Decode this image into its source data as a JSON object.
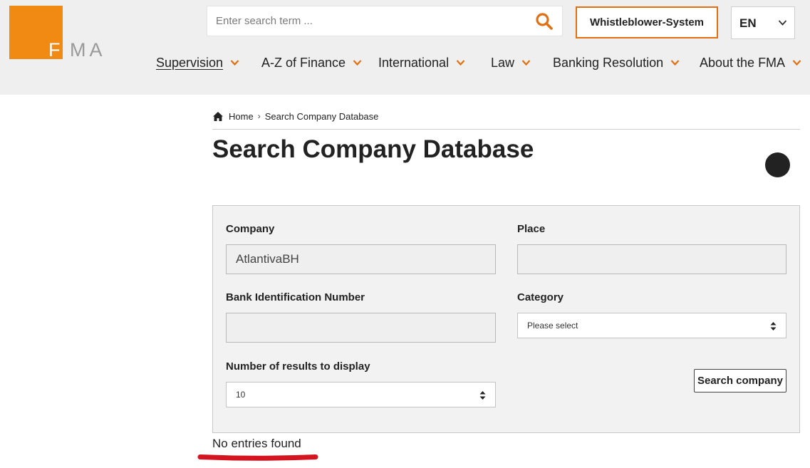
{
  "header": {
    "logo": {
      "letter_f": "F",
      "letters_ma": "MA",
      "brand_color": "#f08a12"
    },
    "search": {
      "placeholder": "Enter search term ...",
      "icon": "search-icon"
    },
    "whistleblower_label": "Whistleblower-System",
    "language": {
      "selected": "EN",
      "icon": "chevron-down-icon"
    }
  },
  "nav": {
    "items": [
      {
        "label": "Supervision",
        "active": true
      },
      {
        "label": "A-Z of Finance"
      },
      {
        "label": "International"
      },
      {
        "label": "Law"
      },
      {
        "label": "Banking Resolution"
      },
      {
        "label": "About the FMA"
      }
    ],
    "accent_color": "#e46f10"
  },
  "breadcrumb": {
    "home": "Home",
    "current": "Search Company Database"
  },
  "page": {
    "title": "Search Company Database"
  },
  "form": {
    "company": {
      "label": "Company",
      "value": "AtlantivaBH"
    },
    "place": {
      "label": "Place",
      "value": ""
    },
    "bin": {
      "label": "Bank Identification Number",
      "value": ""
    },
    "category": {
      "label": "Category",
      "selected": "Please select"
    },
    "results": {
      "label": "Number of results to display",
      "selected": "10"
    },
    "submit_label": "Search company"
  },
  "results": {
    "message": "No entries found",
    "highlight_color": "#d4141e"
  }
}
